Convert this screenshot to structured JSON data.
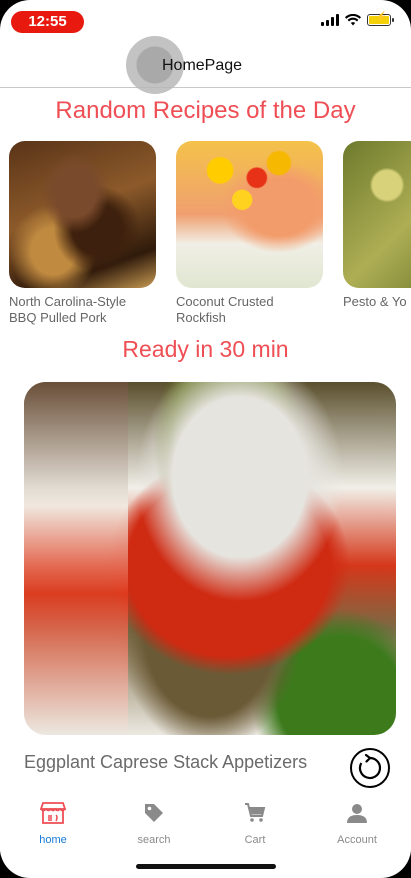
{
  "status_bar": {
    "time": "12:55",
    "time_pill_color": "#e8190e",
    "battery_color": "#f5d10a",
    "icons": [
      "signal-icon",
      "wifi-icon",
      "battery-charging-icon"
    ]
  },
  "app_bar": {
    "title": "HomePage"
  },
  "random_section": {
    "title": "Random Recipes of the Day",
    "recipes": [
      {
        "name": "North Carolina-Style\nBBQ Pulled Pork"
      },
      {
        "name": "Coconut Crusted\nRockfish"
      },
      {
        "name": "Pesto & Yo"
      }
    ]
  },
  "quick_section": {
    "title": "Ready in 30 min",
    "recipe_name": "Eggplant Caprese Stack Appetizers",
    "action_icon": "refresh-icon"
  },
  "bottom_nav": {
    "active_color": "#1a7bd8",
    "accent_color": "#ee4e54",
    "items": [
      {
        "label": "home",
        "icon": "store-icon"
      },
      {
        "label": "search",
        "icon": "tag-icon"
      },
      {
        "label": "Cart",
        "icon": "cart-icon"
      },
      {
        "label": "Account",
        "icon": "person-icon"
      }
    ]
  }
}
